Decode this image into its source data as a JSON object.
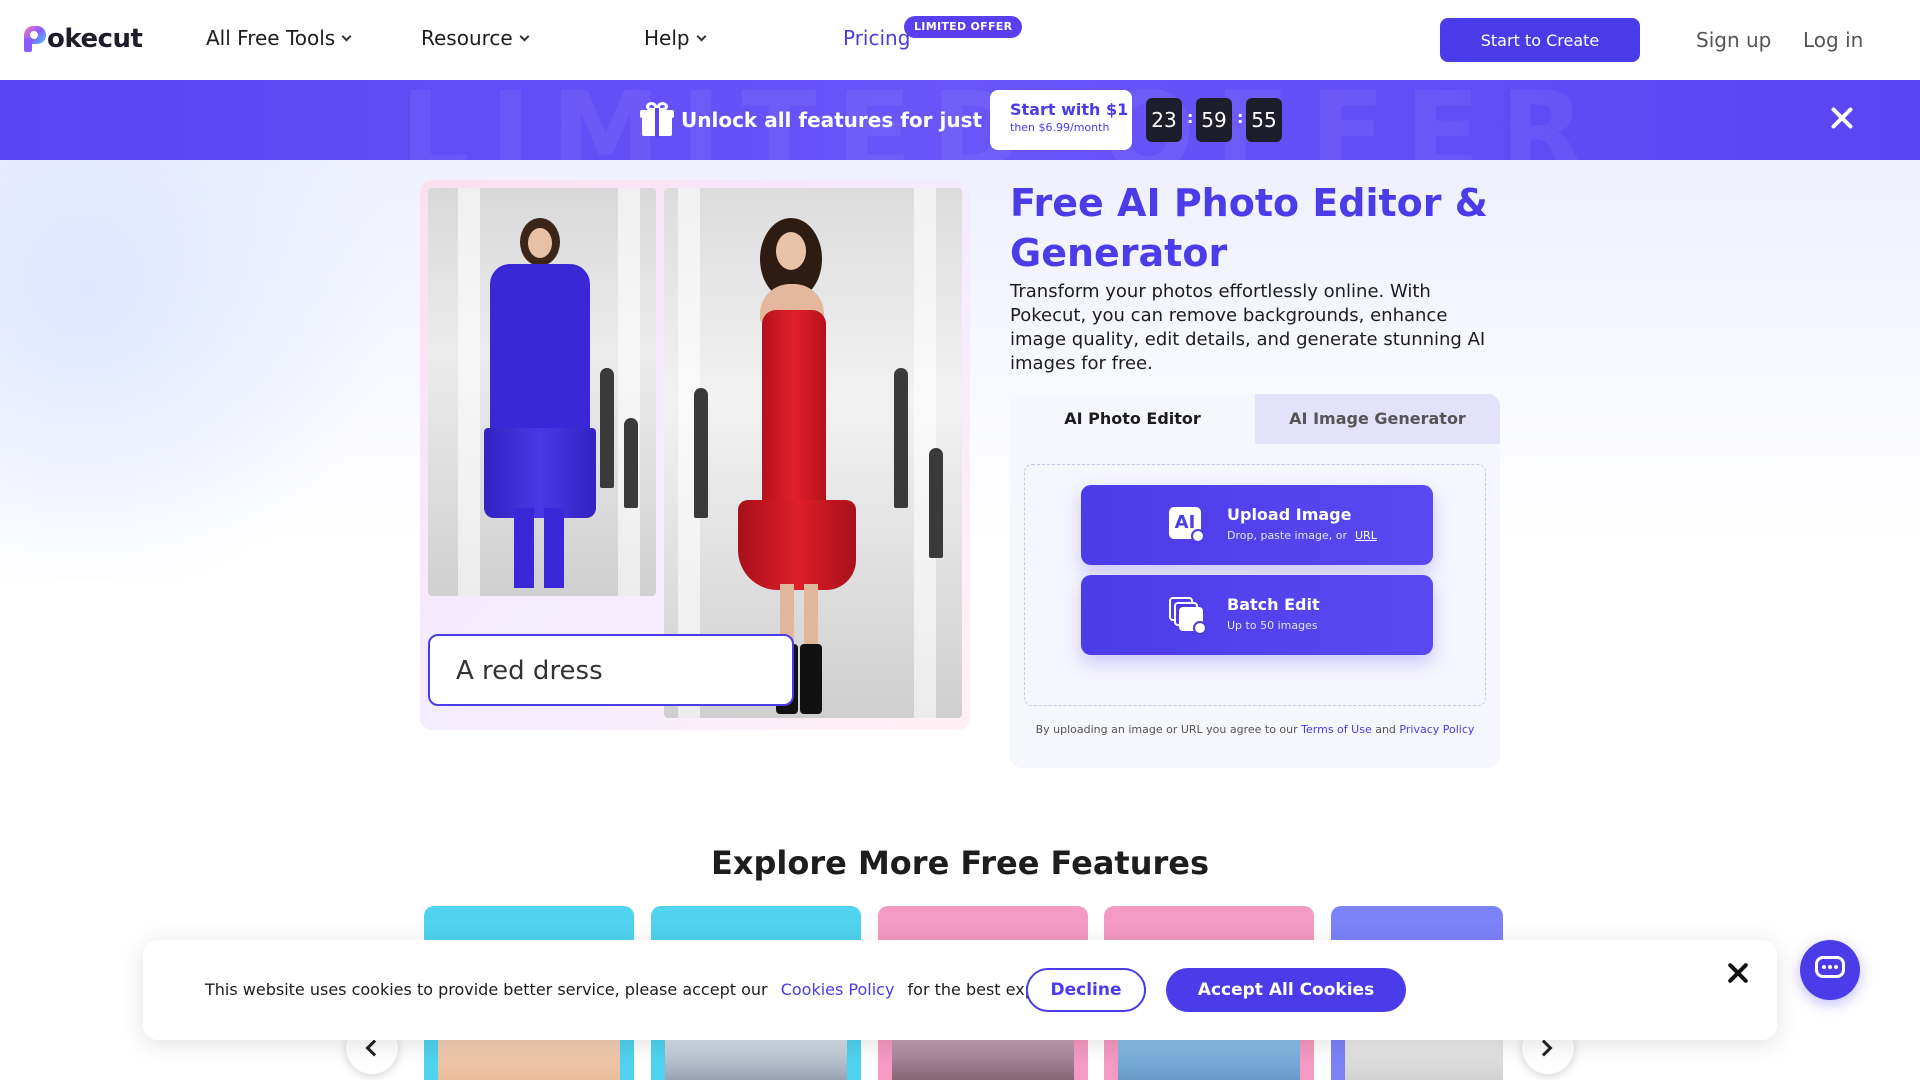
{
  "header": {
    "logo_text": "okecut",
    "nav": [
      {
        "label": "All Free Tools"
      },
      {
        "label": "Resource"
      },
      {
        "label": "Help"
      }
    ],
    "pricing_label": "Pricing",
    "limited_badge": "LIMITED OFFER",
    "create_button": "Start to Create",
    "signup": "Sign up",
    "login": "Log in"
  },
  "offer": {
    "watermark": "LIMITED OFFER",
    "text": "Unlock all features for just $1",
    "start_title": "Start with $1",
    "start_sub": "then $6.99/month",
    "timer": {
      "hours": "23",
      "minutes": "59",
      "seconds": "55"
    }
  },
  "hero": {
    "title": "Free AI Photo Editor & Generator",
    "description": "Transform your photos effortlessly online. With Pokecut, you can remove backgrounds, enhance image quality, edit details, and generate stunning AI images for free.",
    "demo_prompt": "A red dress",
    "tabs": [
      {
        "label": "AI Photo Editor",
        "active": true
      },
      {
        "label": "AI Image Generator",
        "active": false
      }
    ],
    "upload": {
      "title": "Upload Image",
      "sub": "Drop, paste image, or",
      "url_link": "URL"
    },
    "batch": {
      "title": "Batch Edit",
      "sub": "Up to 50 images"
    },
    "agree": {
      "prefix": "By uploading an image or URL you agree to our",
      "terms": "Terms of Use",
      "and": "and",
      "privacy": "Privacy Policy"
    }
  },
  "explore": {
    "title": "Explore More Free Features",
    "cards": [
      {
        "color": "#4fd3ee"
      },
      {
        "color": "#4fd3ee"
      },
      {
        "color": "#f59ac2"
      },
      {
        "color": "#f59ac2"
      },
      {
        "color": "#7c82f8"
      }
    ]
  },
  "cookie": {
    "text_before": "This website uses cookies to provide better service, please accept our",
    "link": "Cookies Policy",
    "text_after": "for the best experience",
    "decline": "Decline",
    "accept": "Accept All Cookies"
  },
  "colors": {
    "brand": "#4a3ce8",
    "red_dress": "#e21f2a",
    "blue_outfit": "#3a28d8"
  }
}
